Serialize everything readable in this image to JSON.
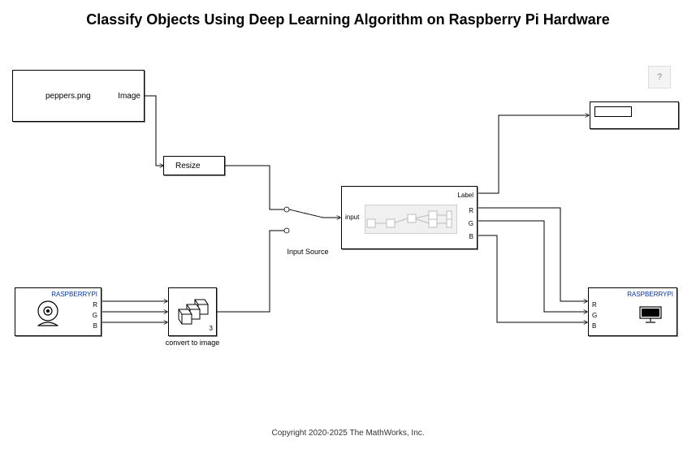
{
  "title": "Classify Objects Using Deep Learning Algorithm on Raspberry Pi Hardware",
  "copyright": "Copyright 2020-2025 The MathWorks, Inc.",
  "help_button": "?",
  "blocks": {
    "image_file": {
      "filename": "peppers.png",
      "port_out": "Image"
    },
    "resize": {
      "label": "Resize"
    },
    "camera": {
      "device": "RASPBERRYPI",
      "ports_out": {
        "r": "R",
        "g": "G",
        "b": "B"
      }
    },
    "concat": {
      "port_out": "3",
      "caption": "convert to image"
    },
    "switch": {
      "caption": "Input Source"
    },
    "dl": {
      "port_in": "input",
      "ports_out": {
        "label": "Label",
        "r": "R",
        "g": "G",
        "b": "B"
      }
    },
    "display_label": {},
    "video_out": {
      "device": "RASPBERRYPI",
      "ports_in": {
        "r": "R",
        "g": "G",
        "b": "B"
      }
    }
  }
}
